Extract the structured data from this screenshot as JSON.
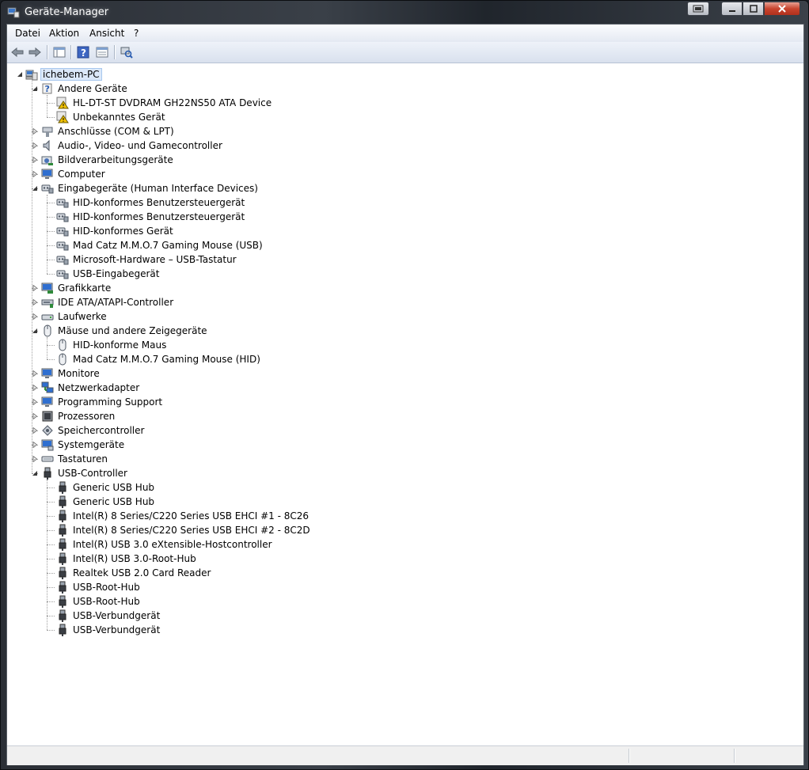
{
  "window": {
    "title": "Geräte-Manager"
  },
  "menu": [
    "Datei",
    "Aktion",
    "Ansicht",
    "?"
  ],
  "toolbar": {
    "buttons": [
      "back-arrow-icon",
      "forward-arrow-icon",
      "show-hide-console-tree-icon",
      "help-icon",
      "properties-icon",
      "scan-hardware-icon"
    ]
  },
  "tree": {
    "root": "ichebem-PC",
    "categories": [
      {
        "label": "Andere Geräte",
        "icon": "unknown-device-icon",
        "expanded": true,
        "children": [
          "HL-DT-ST DVDRAM GH22NS50 ATA Device",
          "Unbekanntes Gerät"
        ]
      },
      {
        "label": "Anschlüsse (COM & LPT)",
        "icon": "port-icon",
        "expanded": false
      },
      {
        "label": "Audio-, Video- und Gamecontroller",
        "icon": "speaker-icon",
        "expanded": false
      },
      {
        "label": "Bildverarbeitungsgeräte",
        "icon": "camera-icon",
        "expanded": false
      },
      {
        "label": "Computer",
        "icon": "monitor-icon",
        "expanded": false
      },
      {
        "label": "Eingabegeräte (Human Interface Devices)",
        "icon": "hid-icon",
        "expanded": true,
        "children": [
          "HID-konformes Benutzersteuergerät",
          "HID-konformes Benutzersteuergerät",
          "HID-konformes Gerät",
          "Mad Catz M.M.O.7 Gaming Mouse (USB)",
          "Microsoft-Hardware – USB-Tastatur",
          "USB-Eingabegerät"
        ]
      },
      {
        "label": "Grafikkarte",
        "icon": "display-adapter-icon",
        "expanded": false
      },
      {
        "label": "IDE ATA/ATAPI-Controller",
        "icon": "ide-controller-icon",
        "expanded": false
      },
      {
        "label": "Laufwerke",
        "icon": "disk-drive-icon",
        "expanded": false
      },
      {
        "label": "Mäuse und andere Zeigegeräte",
        "icon": "mouse-icon",
        "expanded": true,
        "children": [
          "HID-konforme Maus",
          "Mad Catz M.M.O.7 Gaming Mouse (HID)"
        ]
      },
      {
        "label": "Monitore",
        "icon": "monitor-icon",
        "expanded": false
      },
      {
        "label": "Netzwerkadapter",
        "icon": "network-adapter-icon",
        "expanded": false
      },
      {
        "label": "Programming Support",
        "icon": "monitor-icon",
        "expanded": false
      },
      {
        "label": "Prozessoren",
        "icon": "processor-icon",
        "expanded": false
      },
      {
        "label": "Speichercontroller",
        "icon": "storage-controller-icon",
        "expanded": false
      },
      {
        "label": "Systemgeräte",
        "icon": "system-device-icon",
        "expanded": false
      },
      {
        "label": "Tastaturen",
        "icon": "keyboard-icon",
        "expanded": false
      },
      {
        "label": "USB-Controller",
        "icon": "usb-icon",
        "expanded": true,
        "children": [
          "Generic USB Hub",
          "Generic USB Hub",
          "Intel(R) 8 Series/C220 Series USB EHCI #1 - 8C26",
          "Intel(R) 8 Series/C220 Series USB EHCI #2 - 8C2D",
          "Intel(R) USB 3.0 eXtensible-Hostcontroller",
          "Intel(R) USB 3.0-Root-Hub",
          "Realtek USB 2.0 Card Reader",
          "USB-Root-Hub",
          "USB-Root-Hub",
          "USB-Verbundgerät",
          "USB-Verbundgerät"
        ]
      }
    ]
  },
  "colors": {
    "selection": "#dbe8f9",
    "warning": "#f2c200"
  }
}
